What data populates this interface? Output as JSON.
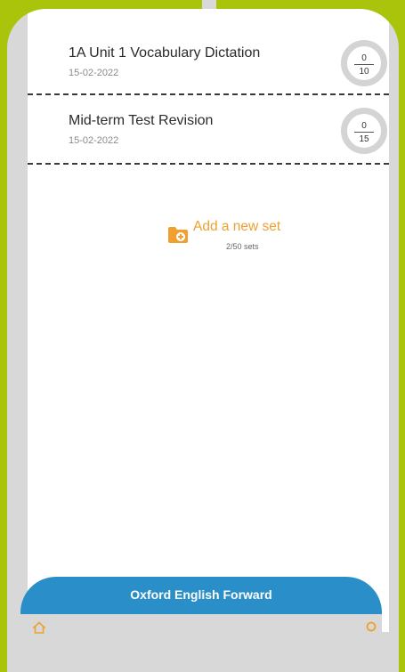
{
  "sets": [
    {
      "title": "1A Unit 1 Vocabulary Dictation",
      "date": "15-02-2022",
      "score": "0",
      "total": "10"
    },
    {
      "title": "Mid-term Test Revision",
      "date": "15-02-2022",
      "score": "0",
      "total": "15"
    }
  ],
  "add_set": {
    "label": "Add a new set",
    "count": "2/50 sets",
    "icon": "folder-add-icon"
  },
  "bottom_bar": {
    "title": "Oxford English Forward"
  },
  "colors": {
    "background": "#a9c40a",
    "accent_orange": "#f0a030",
    "bar_blue": "#2a8fc8"
  }
}
